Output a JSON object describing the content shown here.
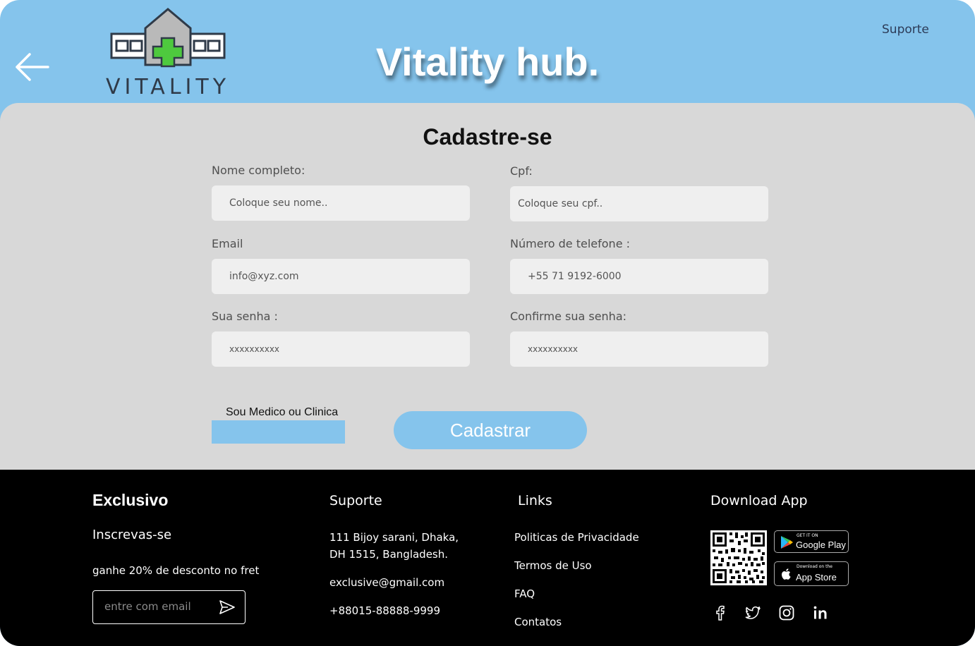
{
  "header": {
    "brand": "Vitality hub.",
    "logo_text": "VITALITY",
    "support_link": "Suporte",
    "back_icon": "arrow-left-icon"
  },
  "form": {
    "title": "Cadastre-se",
    "fields": {
      "name": {
        "label": "Nome completo:",
        "placeholder": "Coloque seu nome.."
      },
      "cpf": {
        "label": "Cpf:",
        "placeholder": "Coloque seu cpf.."
      },
      "email": {
        "label": "Email",
        "placeholder": "info@xyz.com"
      },
      "phone": {
        "label": "Número de telefone :",
        "placeholder": "+55 71 9192-6000"
      },
      "password": {
        "label": "Sua senha :",
        "placeholder": "xxxxxxxxxx"
      },
      "confirm": {
        "label": "Confirme sua senha:",
        "placeholder": "xxxxxxxxxx"
      }
    },
    "doctor_checkbox_label": "Sou Medico ou Clinica",
    "submit_label": "Cadastrar"
  },
  "footer": {
    "exclusive": {
      "title": "Exclusivo",
      "subtitle": "Inscrevas-se",
      "text": "ganhe 20% de desconto no fret",
      "email_placeholder": "entre com email"
    },
    "support": {
      "title": "Suporte",
      "address_line1": "111 Bijoy sarani, Dhaka,",
      "address_line2": "DH 1515, Bangladesh.",
      "email": "exclusive@gmail.com",
      "phone": "+88015-88888-9999"
    },
    "links": {
      "title": "Links",
      "items": [
        "Politicas de Privacidade",
        "Termos de Uso",
        "FAQ",
        "Contatos"
      ]
    },
    "download": {
      "title": "Download App",
      "google_small": "GET IT ON",
      "google_big": "Google Play",
      "apple_small": "Download on the",
      "apple_big": "App Store"
    },
    "social_icons": [
      "facebook-icon",
      "twitter-icon",
      "instagram-icon",
      "linkedin-icon"
    ]
  },
  "colors": {
    "accent": "#85c4ec",
    "panel": "#d8d8d8",
    "input": "#efefef",
    "footer": "#000000"
  }
}
